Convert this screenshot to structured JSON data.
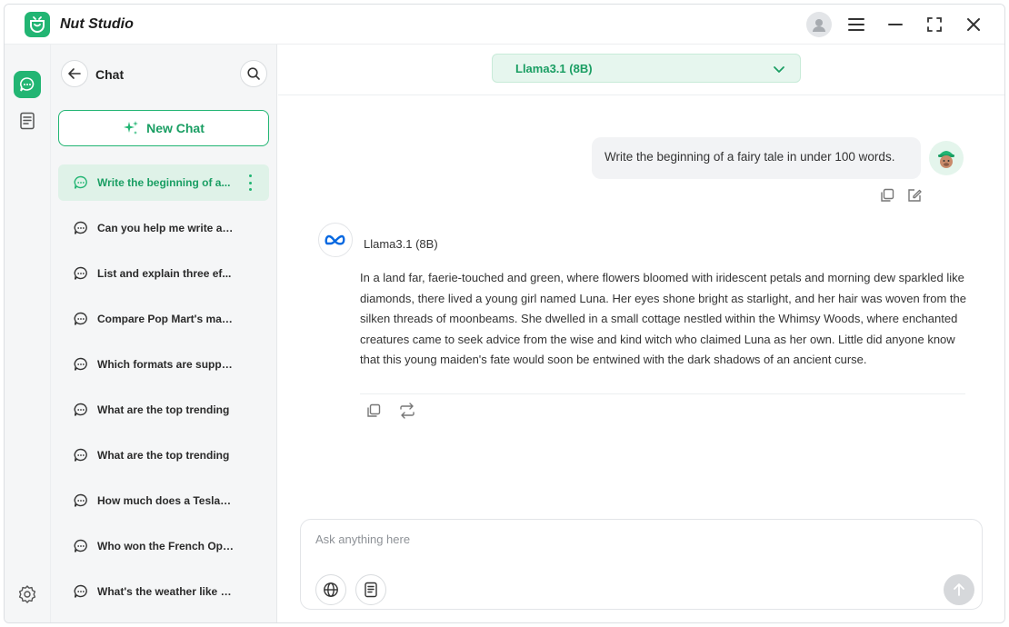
{
  "app": {
    "title": "Nut Studio"
  },
  "titlebar": {
    "icons": [
      "user-avatar-icon",
      "menu-icon",
      "minimize-icon",
      "maximize-icon",
      "close-icon"
    ]
  },
  "rail": {
    "icons": [
      "chat-icon",
      "document-icon",
      "settings-icon"
    ]
  },
  "sidebar": {
    "title": "Chat",
    "new_chat_label": "New Chat",
    "items": [
      {
        "label": "Write the beginning of a...",
        "active": true
      },
      {
        "label": "Can you help me write a ..."
      },
      {
        "label": "List and explain three ef..."
      },
      {
        "label": "Compare Pop Mart's mar..."
      },
      {
        "label": "Which formats are suppor.."
      },
      {
        "label": "What are the top trending"
      },
      {
        "label": "What are the top trending"
      },
      {
        "label": "How much does a Tesla M.."
      },
      {
        "label": "Who won the French Ope.."
      },
      {
        "label": "What's the weather like in ."
      }
    ]
  },
  "model": {
    "selected": "Llama3.1 (8B)"
  },
  "conversation": {
    "user_message": "Write the beginning of a fairy tale in under 100 words.",
    "bot_name": "Llama3.1 (8B)",
    "bot_message": "In a land far, faerie-touched and green, where flowers bloomed with iridescent petals and morning dew sparkled like diamonds, there lived a young girl named Luna. Her eyes shone bright as starlight, and her hair was woven from the silken threads of moonbeams. She dwelled in a small cottage nestled within the Whimsy Woods, where enchanted creatures came to seek advice from the wise and kind witch who claimed Luna as her own. Little did anyone know that this young maiden's fate would soon be entwined with the dark shadows of an ancient curse."
  },
  "composer": {
    "placeholder": "Ask anything here"
  },
  "colors": {
    "accent": "#22b573",
    "accent_dark": "#1a9e63",
    "accent_light": "#dff2e8"
  }
}
